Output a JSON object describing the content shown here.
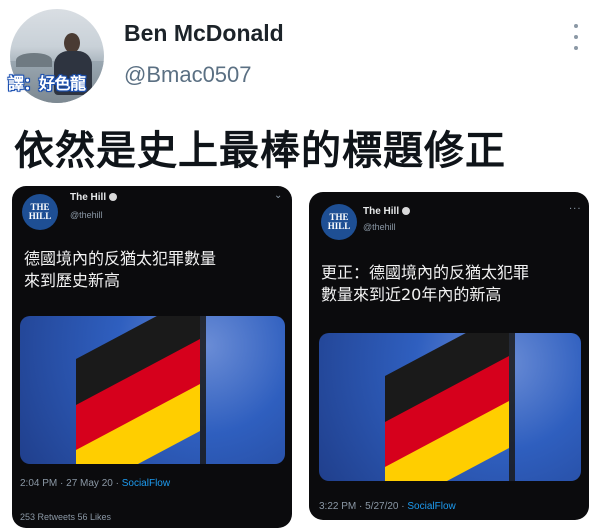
{
  "author": {
    "display_name": "Ben McDonald",
    "handle": "@Bmac0507",
    "avatar_caption": "譯：好色龍"
  },
  "tweet": {
    "text": "依然是史上最棒的標題修正"
  },
  "embedded_tweets": [
    {
      "account": "The Hill",
      "handle": "@thehill",
      "logo_text": "THE HILL",
      "text_lines": [
        "德國境內的反猶太犯罪數量",
        "來到歷史新高"
      ],
      "meta_time": "2:04 PM · 27 May 20 · ",
      "meta_source": "SocialFlow",
      "stats": "253 Retweets   56 Likes"
    },
    {
      "account": "The Hill",
      "handle": "@thehill",
      "logo_text": "THE HILL",
      "text_lines": [
        "更正：德國境內的反猶太犯罪",
        "數量來到近20年內的新高"
      ],
      "meta_time": "3:22 PM · 5/27/20 · ",
      "meta_source": "SocialFlow"
    }
  ],
  "colors": {
    "card_background": "#0b0b0d",
    "flag_black": "#1a1a1a",
    "flag_red": "#d6001c",
    "flag_gold": "#ffce00",
    "sky_blue": "#2f5fbf",
    "link_blue": "#1d9bf0"
  },
  "icons": [
    "more-vertical-icon",
    "verified-badge-icon",
    "chevron-down-icon",
    "more-horizontal-icon"
  ]
}
